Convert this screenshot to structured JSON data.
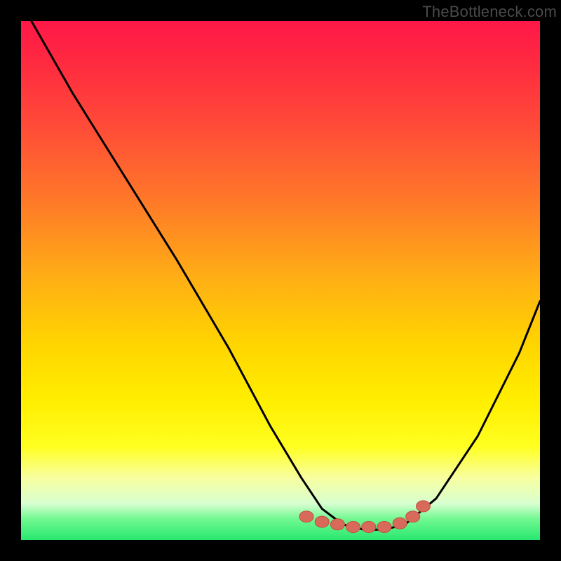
{
  "watermark": "TheBottleneck.com",
  "colors": {
    "bg": "#000000",
    "curve": "#000000",
    "marker": "#d86a5c",
    "marker_edge": "#c64c3c"
  },
  "chart_data": {
    "type": "line",
    "title": "",
    "xlabel": "",
    "ylabel": "",
    "xlim": [
      0,
      100
    ],
    "ylim": [
      0,
      100
    ],
    "grid": false,
    "comment": "No axes or tick labels are shown on the image; data x and y are relative percentages of the plot area. y = 0 is the bottom (green, optimal); y = 100 is the top (red, maximum bottleneck). Curve depicts performance mismatch/bottleneck vs. a component ratio (horizontal axis).",
    "series": [
      {
        "name": "bottleneck-curve",
        "x": [
          2,
          10,
          20,
          30,
          40,
          48,
          54,
          58,
          62,
          66,
          70,
          74,
          80,
          88,
          96,
          100
        ],
        "y": [
          100,
          86,
          70,
          54,
          37,
          22,
          12,
          6,
          3,
          2,
          2,
          3,
          8,
          20,
          36,
          46
        ]
      }
    ],
    "markers": [
      {
        "name": "flat-region-point",
        "x": 55,
        "y": 4.5
      },
      {
        "name": "flat-region-point",
        "x": 58,
        "y": 3.5
      },
      {
        "name": "flat-region-point",
        "x": 61,
        "y": 3.0
      },
      {
        "name": "flat-region-point",
        "x": 64,
        "y": 2.5
      },
      {
        "name": "flat-region-point",
        "x": 67,
        "y": 2.5
      },
      {
        "name": "flat-region-point",
        "x": 70,
        "y": 2.5
      },
      {
        "name": "flat-region-point",
        "x": 73,
        "y": 3.2
      },
      {
        "name": "flat-region-point",
        "x": 75.5,
        "y": 4.5
      },
      {
        "name": "flat-region-point",
        "x": 77.5,
        "y": 6.5
      }
    ]
  }
}
